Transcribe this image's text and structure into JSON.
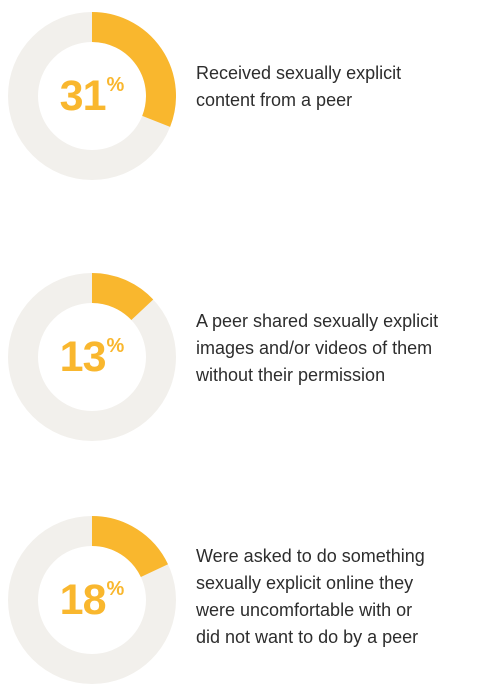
{
  "colors": {
    "accent": "#f9b72e",
    "track": "#f2f0ec",
    "text": "#2d2d2d"
  },
  "chart_data": [
    {
      "type": "pie",
      "title": "",
      "value": 31,
      "label": "31",
      "unit": "%",
      "description": "Received sexually explicit\ncontent from a peer"
    },
    {
      "type": "pie",
      "title": "",
      "value": 13,
      "label": "13",
      "unit": "%",
      "description": "A peer shared sexually explicit\nimages and/or videos of them\nwithout their permission"
    },
    {
      "type": "pie",
      "title": "",
      "value": 18,
      "label": "18",
      "unit": "%",
      "description": "Were asked to do something\nsexually explicit online they\nwere uncomfortable with or\ndid not want to do by a peer"
    }
  ]
}
